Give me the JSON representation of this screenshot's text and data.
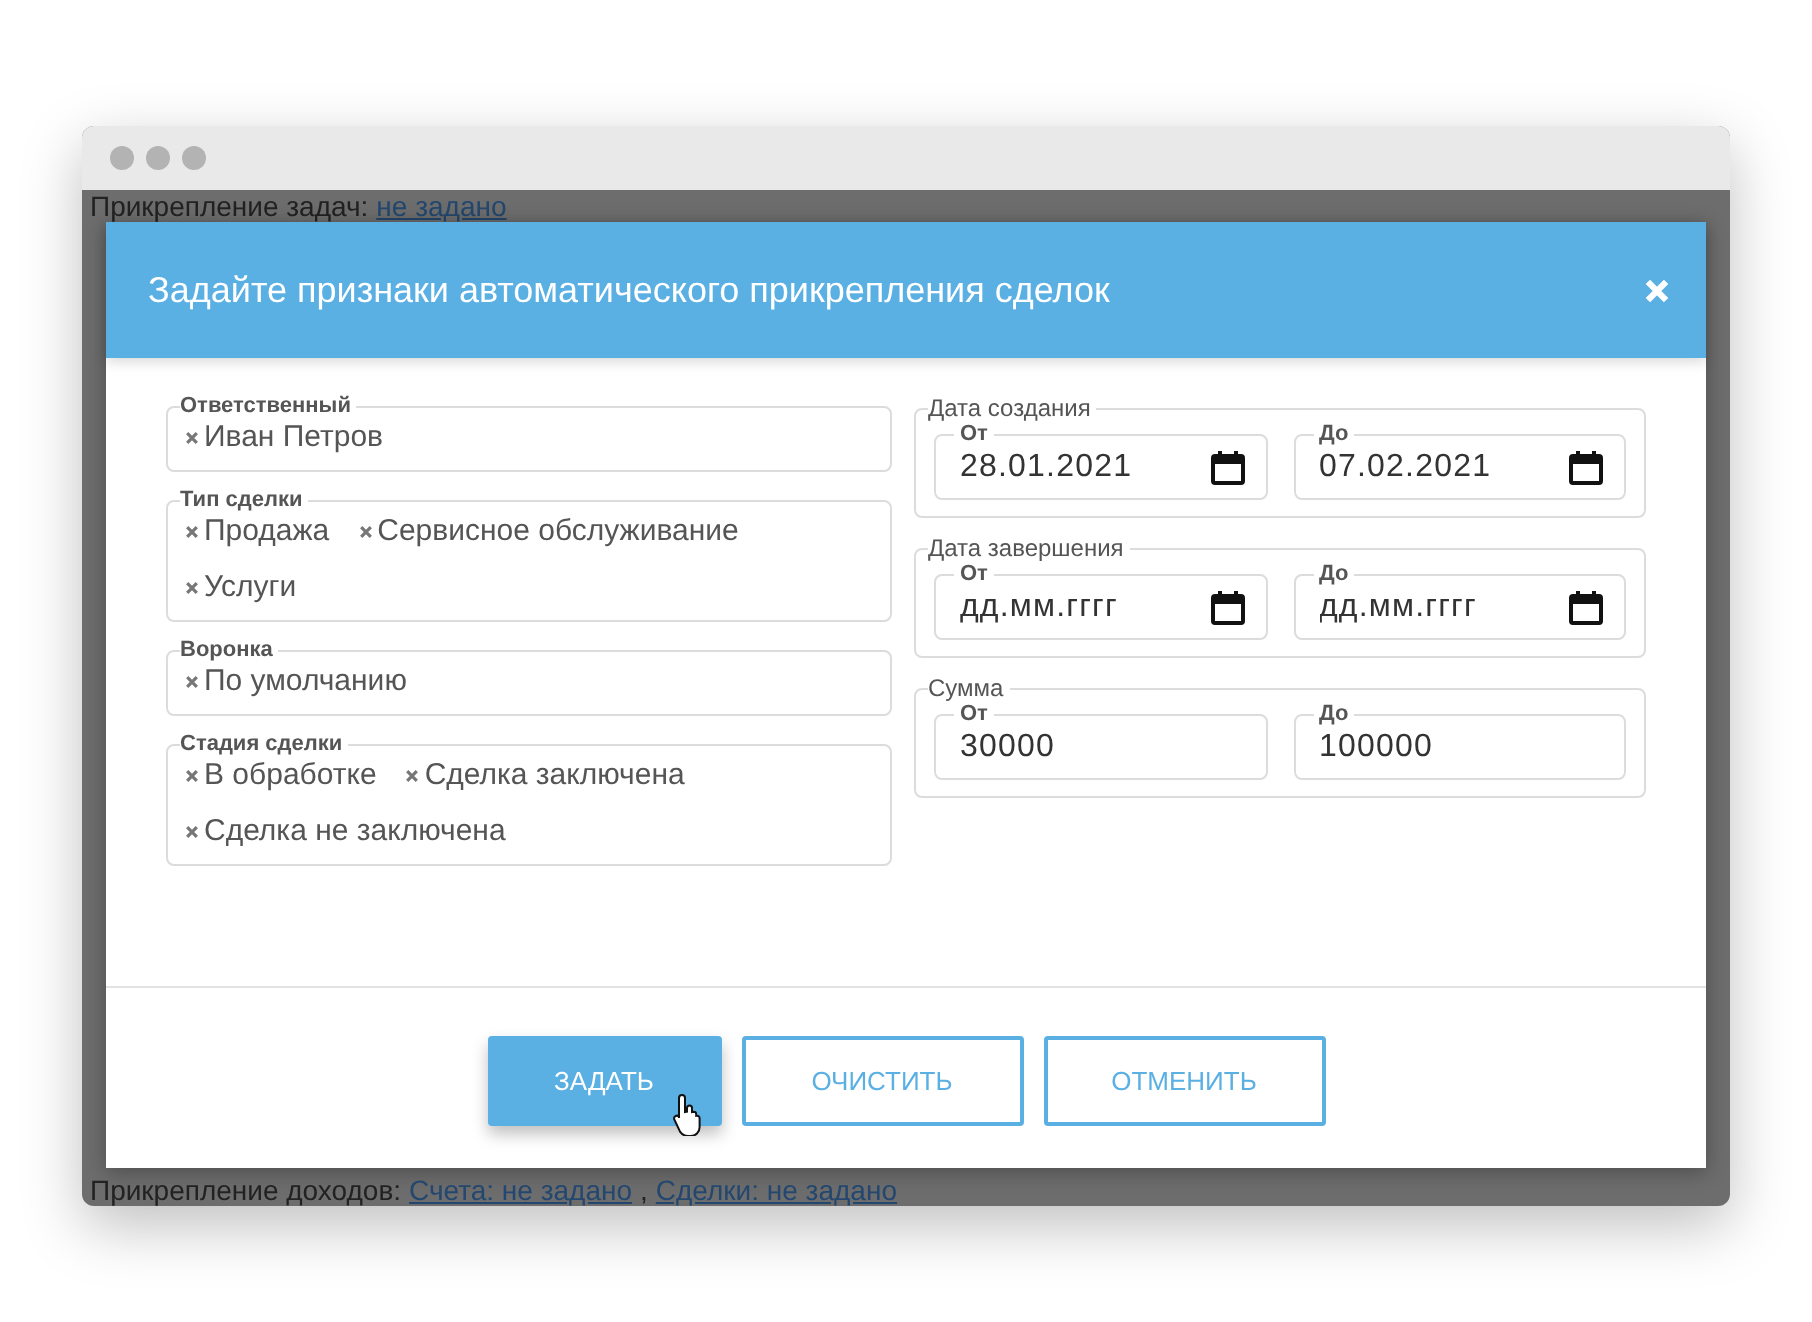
{
  "background": {
    "top_line": {
      "label": "Прикрепление задач:",
      "links": [
        "не задано"
      ]
    },
    "bottom_line": {
      "label": "Прикрепление доходов:",
      "links": [
        "Счета: не задано",
        "Сделки: не задано"
      ],
      "separator": ","
    }
  },
  "dialog": {
    "title": "Задайте признаки автоматического прикрепления сделок",
    "tag_fields": [
      {
        "label": "Ответственный",
        "tags": [
          "Иван Петров"
        ]
      },
      {
        "label": "Тип сделки",
        "tags": [
          "Продажа",
          "Сервисное обслуживание",
          "Услуги"
        ]
      },
      {
        "label": "Воронка",
        "tags": [
          "По умолчанию"
        ]
      },
      {
        "label": "Стадия сделки",
        "tags": [
          "В обработке",
          "Сделка заключена",
          "Сделка не заключена"
        ]
      }
    ],
    "range_groups": [
      {
        "label": "Дата создания",
        "kind": "date",
        "fields": [
          {
            "label": "От",
            "value": "28.01.2021"
          },
          {
            "label": "До",
            "value": "07.02.2021"
          }
        ]
      },
      {
        "label": "Дата завершения",
        "kind": "date",
        "fields": [
          {
            "label": "От",
            "placeholder": "дд.мм.гггг"
          },
          {
            "label": "До",
            "placeholder": "дд.мм.гггг"
          }
        ]
      },
      {
        "label": "Сумма",
        "kind": "number",
        "fields": [
          {
            "label": "От",
            "value": "30000"
          },
          {
            "label": "До",
            "value": "100000"
          }
        ]
      }
    ],
    "buttons": [
      {
        "label": "ЗАДАТЬ",
        "kind": "primary"
      },
      {
        "label": "ОЧИСТИТЬ",
        "kind": "outline"
      },
      {
        "label": "ОТМЕНИТЬ",
        "kind": "outline"
      }
    ]
  }
}
